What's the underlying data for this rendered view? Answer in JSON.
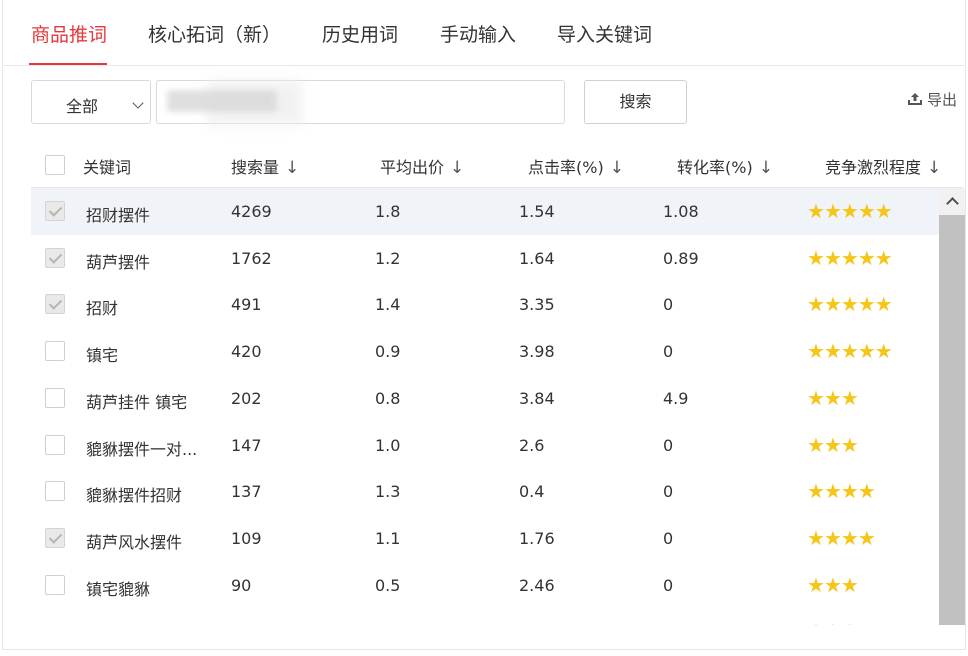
{
  "tabs": [
    {
      "label": "商品推词",
      "active": true
    },
    {
      "label": "核心拓词（新）",
      "active": false
    },
    {
      "label": "历史用词",
      "active": false
    },
    {
      "label": "手动输入",
      "active": false
    },
    {
      "label": "导入关键词",
      "active": false
    }
  ],
  "filter": {
    "selected": "全部"
  },
  "search": {
    "button": "搜索"
  },
  "export_label": "导出",
  "table": {
    "headers": {
      "keyword": "关键词",
      "search_volume": "搜索量",
      "avg_bid": "平均出价",
      "ctr": "点击率(%)",
      "cvr": "转化率(%)",
      "competition": "竞争激烈程度"
    },
    "sort_arrow": "↓",
    "rows": [
      {
        "checked": true,
        "keyword": "招财摆件",
        "volume": "4269",
        "bid": "1.8",
        "ctr": "1.54",
        "cvr": "1.08",
        "stars": 5
      },
      {
        "checked": true,
        "keyword": "葫芦摆件",
        "volume": "1762",
        "bid": "1.2",
        "ctr": "1.64",
        "cvr": "0.89",
        "stars": 5
      },
      {
        "checked": true,
        "keyword": "招财",
        "volume": "491",
        "bid": "1.4",
        "ctr": "3.35",
        "cvr": "0",
        "stars": 5
      },
      {
        "checked": false,
        "keyword": "镇宅",
        "volume": "420",
        "bid": "0.9",
        "ctr": "3.98",
        "cvr": "0",
        "stars": 5
      },
      {
        "checked": false,
        "keyword": "葫芦挂件 镇宅",
        "volume": "202",
        "bid": "0.8",
        "ctr": "3.84",
        "cvr": "4.9",
        "stars": 3
      },
      {
        "checked": false,
        "keyword": "貔貅摆件一对...",
        "volume": "147",
        "bid": "1.0",
        "ctr": "2.6",
        "cvr": "0",
        "stars": 3
      },
      {
        "checked": false,
        "keyword": "貔貅摆件招财",
        "volume": "137",
        "bid": "1.3",
        "ctr": "0.4",
        "cvr": "0",
        "stars": 4
      },
      {
        "checked": true,
        "keyword": "葫芦风水摆件",
        "volume": "109",
        "bid": "1.1",
        "ctr": "1.76",
        "cvr": "0",
        "stars": 4
      },
      {
        "checked": false,
        "keyword": "镇宅貔貅",
        "volume": "90",
        "bid": "0.5",
        "ctr": "2.46",
        "cvr": "0",
        "stars": 3
      }
    ]
  },
  "colors": {
    "accent": "#e4393c",
    "star": "#f5c518",
    "row_highlight": "#f0f4f8"
  }
}
